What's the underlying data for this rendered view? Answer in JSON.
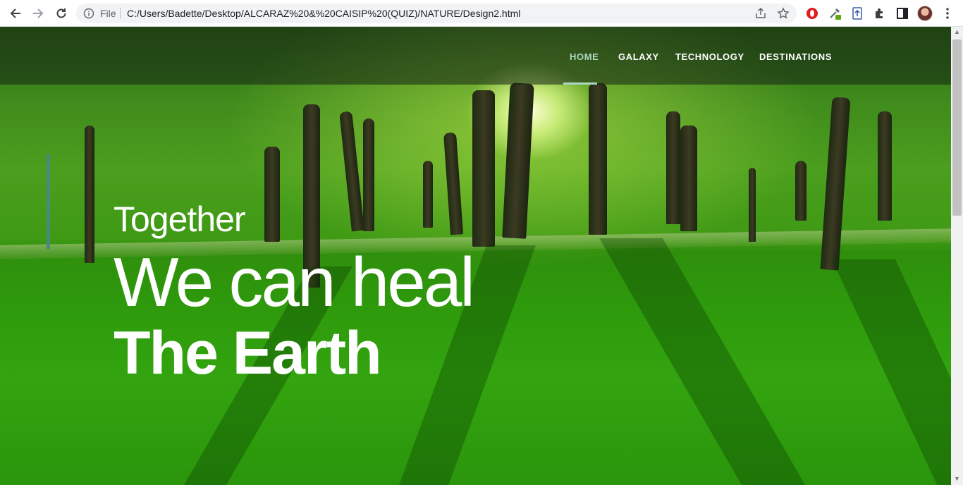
{
  "browser": {
    "file_label": "File",
    "url": "C:/Users/Badette/Desktop/ALCARAZ%20&%20CAISIP%20(QUIZ)/NATURE/Design2.html"
  },
  "nav": {
    "items": [
      {
        "label": "HOME",
        "active": true
      },
      {
        "label": "GALAXY",
        "active": false
      },
      {
        "label": "TECHNOLOGY",
        "active": false
      },
      {
        "label": "DESTINATIONS",
        "active": false
      }
    ]
  },
  "hero": {
    "line1": "Together",
    "line2": "We can heal",
    "line3": "The Earth"
  },
  "colors": {
    "active_nav": "#a7d8c0",
    "nav_text": "#ffffff",
    "hero_text": "#ffffff"
  }
}
